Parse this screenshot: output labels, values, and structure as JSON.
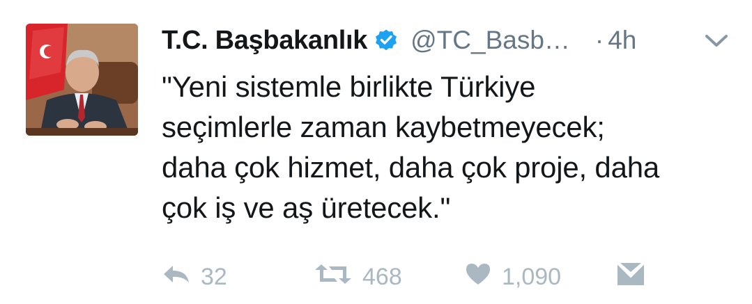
{
  "tweet": {
    "display_name": "T.C. Başbakanlık",
    "handle": "@TC_Basb…",
    "dot": "·",
    "time": "4h",
    "verified": true,
    "body_lines": [
      "\"Yeni sistemle birlikte Türkiye",
      "seçimlerle zaman kaybetmeyecek;",
      "daha çok hizmet, daha çok proje, daha",
      "çok iş ve aş üretecek.\""
    ],
    "actions": {
      "reply_count": "32",
      "retweet_count": "468",
      "like_count": "1,090"
    }
  },
  "icons": {
    "verified": "verified-badge-icon",
    "caret": "chevron-down-icon",
    "reply": "reply-icon",
    "retweet": "retweet-icon",
    "like": "heart-icon",
    "dm": "envelope-icon"
  },
  "colors": {
    "verified_blue": "#1da1f2",
    "muted": "#657786",
    "action_gray": "#aab8c2",
    "text": "#14171a"
  }
}
